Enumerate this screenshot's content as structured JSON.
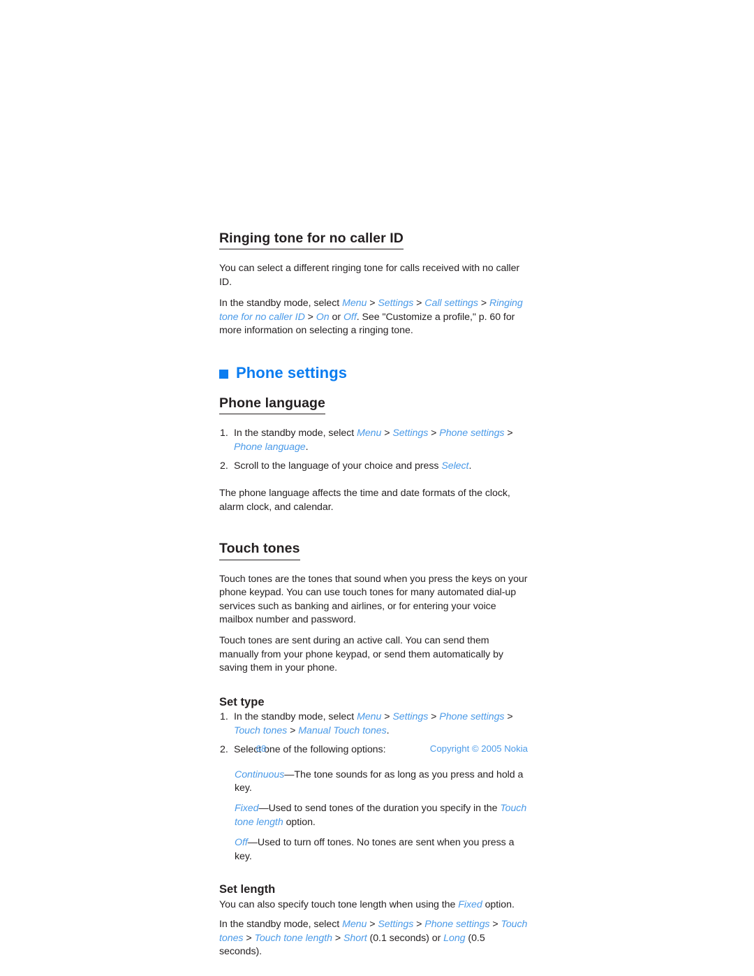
{
  "document": {
    "section_ringing": {
      "heading": "Ringing tone for no caller ID",
      "para1": "You can select a different ringing tone for calls received with no caller ID.",
      "para2_lead": "In the standby mode, select ",
      "para2_path": [
        "Menu",
        "Settings",
        "Call settings",
        "Ringing tone for no caller ID",
        "On"
      ],
      "para2_or": " or ",
      "para2_off": "Off",
      "para2_tail": ". See \"Customize a profile,\" p. 60 for more information on selecting a ringing tone."
    },
    "section_phone_settings": {
      "bullet_icon": "square-bullet-icon",
      "heading": "Phone settings"
    },
    "section_phone_language": {
      "heading": "Phone language",
      "steps": [
        {
          "number": "1.",
          "lead": "In the standby mode, select ",
          "path": [
            "Menu",
            "Settings",
            "Phone settings",
            "Phone language"
          ],
          "tail": "."
        },
        {
          "number": "2.",
          "lead": "Scroll to the language of your choice and press ",
          "path": [
            "Select"
          ],
          "tail": "."
        }
      ],
      "para_after": "The phone language affects the time and date formats of the clock, alarm clock, and calendar."
    },
    "section_touch_tones": {
      "heading": "Touch tones",
      "para1": "Touch tones are the tones that sound when you press the keys on your phone keypad. You can use touch tones for many automated dial-up services such as banking and airlines, or for entering your voice mailbox number and password.",
      "para2": "Touch tones are sent during an active call. You can send them manually from your phone keypad, or send them automatically by saving them in your phone."
    },
    "section_set_type": {
      "heading": "Set type",
      "steps": [
        {
          "number": "1.",
          "lead": "In the standby mode, select ",
          "path": [
            "Menu",
            "Settings",
            "Phone settings",
            "Touch tones",
            "Manual Touch tones"
          ],
          "tail": "."
        },
        {
          "number": "2.",
          "lead": "Select one of the following options:",
          "path": [],
          "tail": ""
        }
      ],
      "options": [
        {
          "term": "Continuous",
          "dash": "—",
          "desc": "The tone sounds for as long as you press and hold a key."
        },
        {
          "term": "Fixed",
          "dash": "—",
          "desc_pre": "Used to send tones of the duration you specify in the ",
          "desc_link": "Touch tone length",
          "desc_post": " option."
        },
        {
          "term": "Off",
          "dash": "—",
          "desc": "Used to turn off tones. No tones are sent when you press a key."
        }
      ]
    },
    "section_set_length": {
      "heading": "Set length",
      "para1_pre": "You can also specify touch tone length when using the ",
      "para1_link": "Fixed",
      "para1_post": " option.",
      "para2_lead": "In the standby mode, select ",
      "para2_path": [
        "Menu",
        "Settings",
        "Phone settings",
        "Touch tones",
        "Touch tone length",
        "Short"
      ],
      "para2_short_note": " (0.1 seconds) or ",
      "para2_long": "Long",
      "para2_tail": " (0.5 seconds)."
    }
  },
  "footer": {
    "page_number": "68",
    "copyright": "Copyright © 2005 Nokia"
  },
  "colors": {
    "link_blue": "#4a9ae8",
    "heading_blue": "#0a7cf0",
    "body_text": "#231f20",
    "page_background": "#ffffff"
  },
  "separator": ">"
}
